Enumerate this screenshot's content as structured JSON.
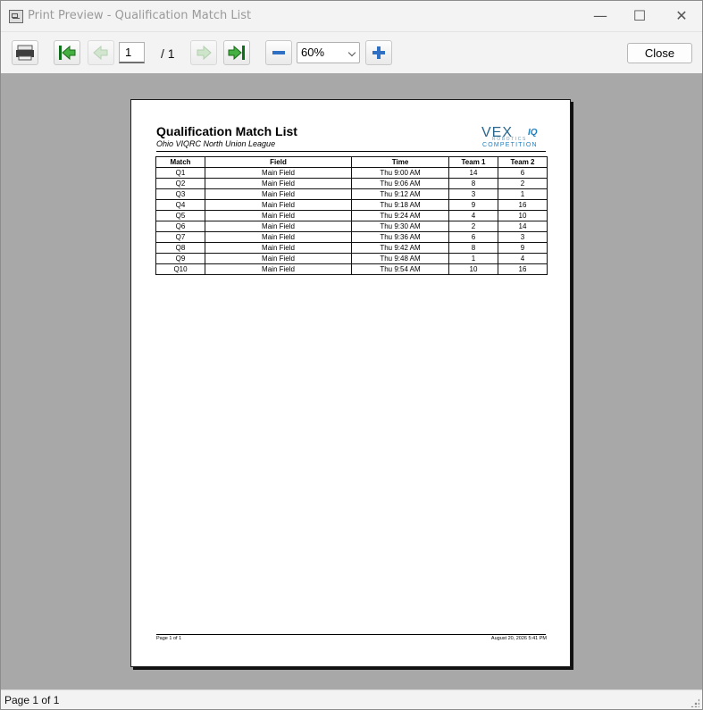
{
  "window": {
    "title": "Print Preview - Qualification Match List"
  },
  "toolbar": {
    "page_value": "1",
    "page_total": "/ 1",
    "zoom": "60%",
    "close_label": "Close",
    "icons": [
      "printer-icon",
      "first-page-icon",
      "previous-page-icon",
      "next-page-icon",
      "last-page-icon",
      "zoom-out-icon",
      "zoom-in-icon"
    ]
  },
  "report": {
    "title": "Qualification Match List",
    "subtitle": "Ohio VIQRC North Union League",
    "logo": {
      "main": "VEX",
      "iq": "IQ",
      "sub": "ROBOTICS",
      "comp": "COMPETITION"
    },
    "columns": [
      "Match",
      "Field",
      "Time",
      "Team 1",
      "Team 2"
    ],
    "rows": [
      [
        "Q1",
        "Main Field",
        "Thu 9:00 AM",
        "14",
        "6"
      ],
      [
        "Q2",
        "Main Field",
        "Thu 9:06 AM",
        "8",
        "2"
      ],
      [
        "Q3",
        "Main Field",
        "Thu 9:12 AM",
        "3",
        "1"
      ],
      [
        "Q4",
        "Main Field",
        "Thu 9:18 AM",
        "9",
        "16"
      ],
      [
        "Q5",
        "Main Field",
        "Thu 9:24 AM",
        "4",
        "10"
      ],
      [
        "Q6",
        "Main Field",
        "Thu 9:30 AM",
        "2",
        "14"
      ],
      [
        "Q7",
        "Main Field",
        "Thu 9:36 AM",
        "6",
        "3"
      ],
      [
        "Q8",
        "Main Field",
        "Thu 9:42 AM",
        "8",
        "9"
      ],
      [
        "Q9",
        "Main Field",
        "Thu 9:48 AM",
        "1",
        "4"
      ],
      [
        "Q10",
        "Main Field",
        "Thu 9:54 AM",
        "10",
        "16"
      ]
    ],
    "footer_left": "Page 1 of 1",
    "footer_right": "August 20, 2026 5:41 PM"
  },
  "status": {
    "text": "Page 1 of 1"
  },
  "colors": {
    "window": "#f3f3f3",
    "preview_bg": "#a8a8a8",
    "icon_green": "#3e9c3e",
    "zoom_blue": "#2f6fc4"
  }
}
